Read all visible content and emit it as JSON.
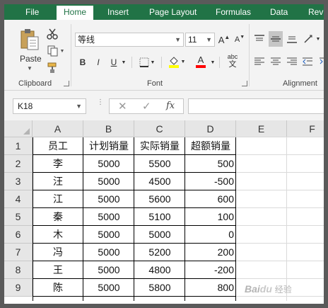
{
  "ribbon_tabs": [
    {
      "label": "File",
      "active": false
    },
    {
      "label": "Home",
      "active": true
    },
    {
      "label": "Insert",
      "active": false
    },
    {
      "label": "Page Layout",
      "active": false
    },
    {
      "label": "Formulas",
      "active": false
    },
    {
      "label": "Data",
      "active": false
    },
    {
      "label": "Revi",
      "active": false
    }
  ],
  "clipboard": {
    "paste_label": "Paste",
    "group_label": "Clipboard"
  },
  "font": {
    "font_name": "等线",
    "font_size": "11",
    "grow_label": "A",
    "shrink_label": "A",
    "bold_label": "B",
    "italic_label": "I",
    "underline_label": "U",
    "font_color_label": "A",
    "group_label": "Font"
  },
  "alignment": {
    "group_label": "Alignment",
    "wrap_label": "abc"
  },
  "formula_bar": {
    "name_box": "K18",
    "fx_label": "fx",
    "formula_value": ""
  },
  "colors": {
    "excel_green": "#217346",
    "highlight_yellow": "#ffff00",
    "font_red": "#ff0000"
  },
  "sheet": {
    "column_headers": [
      "A",
      "B",
      "C",
      "D",
      "E",
      "F"
    ],
    "row_headers": [
      "1",
      "2",
      "3",
      "4",
      "5",
      "6",
      "7",
      "8",
      "9"
    ],
    "rows": [
      [
        "员工",
        "计划销量",
        "实际销量",
        "超额销量"
      ],
      [
        "李",
        "5000",
        "5500",
        "500"
      ],
      [
        "汪",
        "5000",
        "4500",
        "-500"
      ],
      [
        "江",
        "5000",
        "5600",
        "600"
      ],
      [
        "秦",
        "5000",
        "5100",
        "100"
      ],
      [
        "木",
        "5000",
        "5000",
        "0"
      ],
      [
        "冯",
        "5000",
        "5200",
        "200"
      ],
      [
        "王",
        "5000",
        "4800",
        "-200"
      ],
      [
        "陈",
        "5000",
        "5800",
        "800"
      ]
    ]
  },
  "watermark": "Baidu 经验"
}
